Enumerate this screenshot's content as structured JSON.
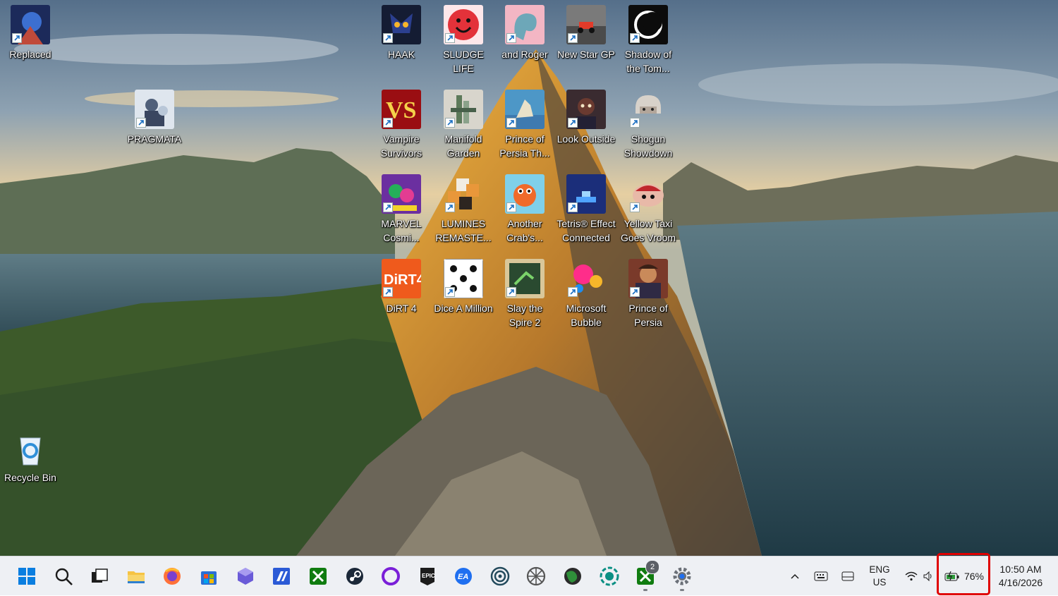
{
  "desktop": {
    "icons": [
      {
        "label": "Replaced",
        "icon": "replaced-game-icon",
        "color": "#1c2a5a"
      },
      {
        "label": "PRAGMATA",
        "icon": "pragmata-game-icon",
        "color": "#dfe6ee"
      },
      {
        "label": "HAAK",
        "icon": "haak-game-icon",
        "color": "#141c33"
      },
      {
        "label": "SLUDGE LIFE",
        "icon": "sludge-life-icon",
        "color": "#e3323a"
      },
      {
        "label": "and Roger",
        "icon": "and-roger-icon",
        "color": "#f3b6c4"
      },
      {
        "label": "New Star GP",
        "icon": "new-star-gp-icon",
        "color": "#7a7a7a"
      },
      {
        "label": "Shadow of the Tom...",
        "icon": "shadow-of-the-tomb-raider-icon",
        "color": "#0c0c0c"
      },
      {
        "label": "Vampire Survivors",
        "icon": "vampire-survivors-icon",
        "color": "#9a0e12"
      },
      {
        "label": "Manifold Garden",
        "icon": "manifold-garden-icon",
        "color": "#d8d5cc"
      },
      {
        "label": "Prince of Persia Th...",
        "icon": "prince-of-persia-lost-crown-icon",
        "color": "#4d97c7"
      },
      {
        "label": "Look Outside",
        "icon": "look-outside-icon",
        "color": "#3a2b30"
      },
      {
        "label": "Shogun Showdown",
        "icon": "shogun-showdown-icon",
        "color": "#ffffff"
      },
      {
        "label": "MARVEL Cosmi...",
        "icon": "marvel-cosmic-invasion-icon",
        "color": "#6b2fa0"
      },
      {
        "label": "LUMINES REMASTE...",
        "icon": "lumines-remastered-icon",
        "color": "#2d2520"
      },
      {
        "label": "Another Crab's...",
        "icon": "another-crabs-treasure-icon",
        "color": "#7fd0ea"
      },
      {
        "label": "Tetris® Effect Connected",
        "icon": "tetris-effect-icon",
        "color": "#1b2e7a"
      },
      {
        "label": "Yellow Taxi Goes Vroom",
        "icon": "yellow-taxi-goes-vroom-icon",
        "color": "#e8b9a8"
      },
      {
        "label": "DiRT 4",
        "icon": "dirt-4-icon",
        "color": "#ef5a1c"
      },
      {
        "label": "Dice A Million",
        "icon": "dice-a-million-icon",
        "color": "#ffffff"
      },
      {
        "label": "Slay the Spire 2",
        "icon": "slay-the-spire-2-icon",
        "color": "#2a4a30"
      },
      {
        "label": "Microsoft Bubble",
        "icon": "microsoft-bubble-icon",
        "color": "#ff2d8a"
      },
      {
        "label": "Prince of Persia",
        "icon": "prince-of-persia-icon",
        "color": "#7a3a2a"
      },
      {
        "label": "Recycle Bin",
        "icon": "recycle-bin-icon",
        "color": "#2f8fd8"
      }
    ]
  },
  "taskbar": {
    "apps": [
      {
        "name": "start-button",
        "icon": "windows-logo-icon",
        "color": "#0a7ee0"
      },
      {
        "name": "search-button",
        "icon": "search-icon",
        "color": "#1c1c1c"
      },
      {
        "name": "task-view-button",
        "icon": "task-view-icon",
        "color": "#1c1c1c"
      },
      {
        "name": "file-explorer-button",
        "icon": "folder-icon",
        "color": "#f6c343"
      },
      {
        "name": "firefox-button",
        "icon": "firefox-icon",
        "color": "#ff7139"
      },
      {
        "name": "microsoft-store-button",
        "icon": "store-icon",
        "color": "#2a6fd6"
      },
      {
        "name": "app-cube-button",
        "icon": "cube-icon",
        "color": "#6a5bd8"
      },
      {
        "name": "app-blue-square-button",
        "icon": "blue-square-icon",
        "color": "#2b5ad6"
      },
      {
        "name": "xbox-button",
        "icon": "xbox-icon",
        "color": "#107c10"
      },
      {
        "name": "steam-button",
        "icon": "steam-icon",
        "color": "#1b2838"
      },
      {
        "name": "app-purple-ring-button",
        "icon": "purple-ring-icon",
        "color": "#7a1fd8"
      },
      {
        "name": "epic-games-button",
        "icon": "epic-games-icon",
        "color": "#1c1c1c"
      },
      {
        "name": "ea-app-button",
        "icon": "ea-icon",
        "color": "#1f6ff0"
      },
      {
        "name": "app-spiral-button",
        "icon": "spiral-icon",
        "color": "#234a5c"
      },
      {
        "name": "app-wheel-button",
        "icon": "wheel-icon",
        "color": "#555555"
      },
      {
        "name": "app-globe-button",
        "icon": "globe-icon",
        "color": "#2f8f3a"
      },
      {
        "name": "app-teal-circle-button",
        "icon": "teal-circle-icon",
        "color": "#0a8f83"
      },
      {
        "name": "xbox-game-bar-button",
        "icon": "xbox-icon",
        "color": "#107c10"
      },
      {
        "name": "settings-button",
        "icon": "gear-icon",
        "color": "#6b7078"
      }
    ],
    "xbox_badge": "2",
    "tray": {
      "lang_top": "ENG",
      "lang_bottom": "US",
      "battery_percent": "76%",
      "time": "10:50 AM",
      "date": "4/16/2026"
    }
  }
}
